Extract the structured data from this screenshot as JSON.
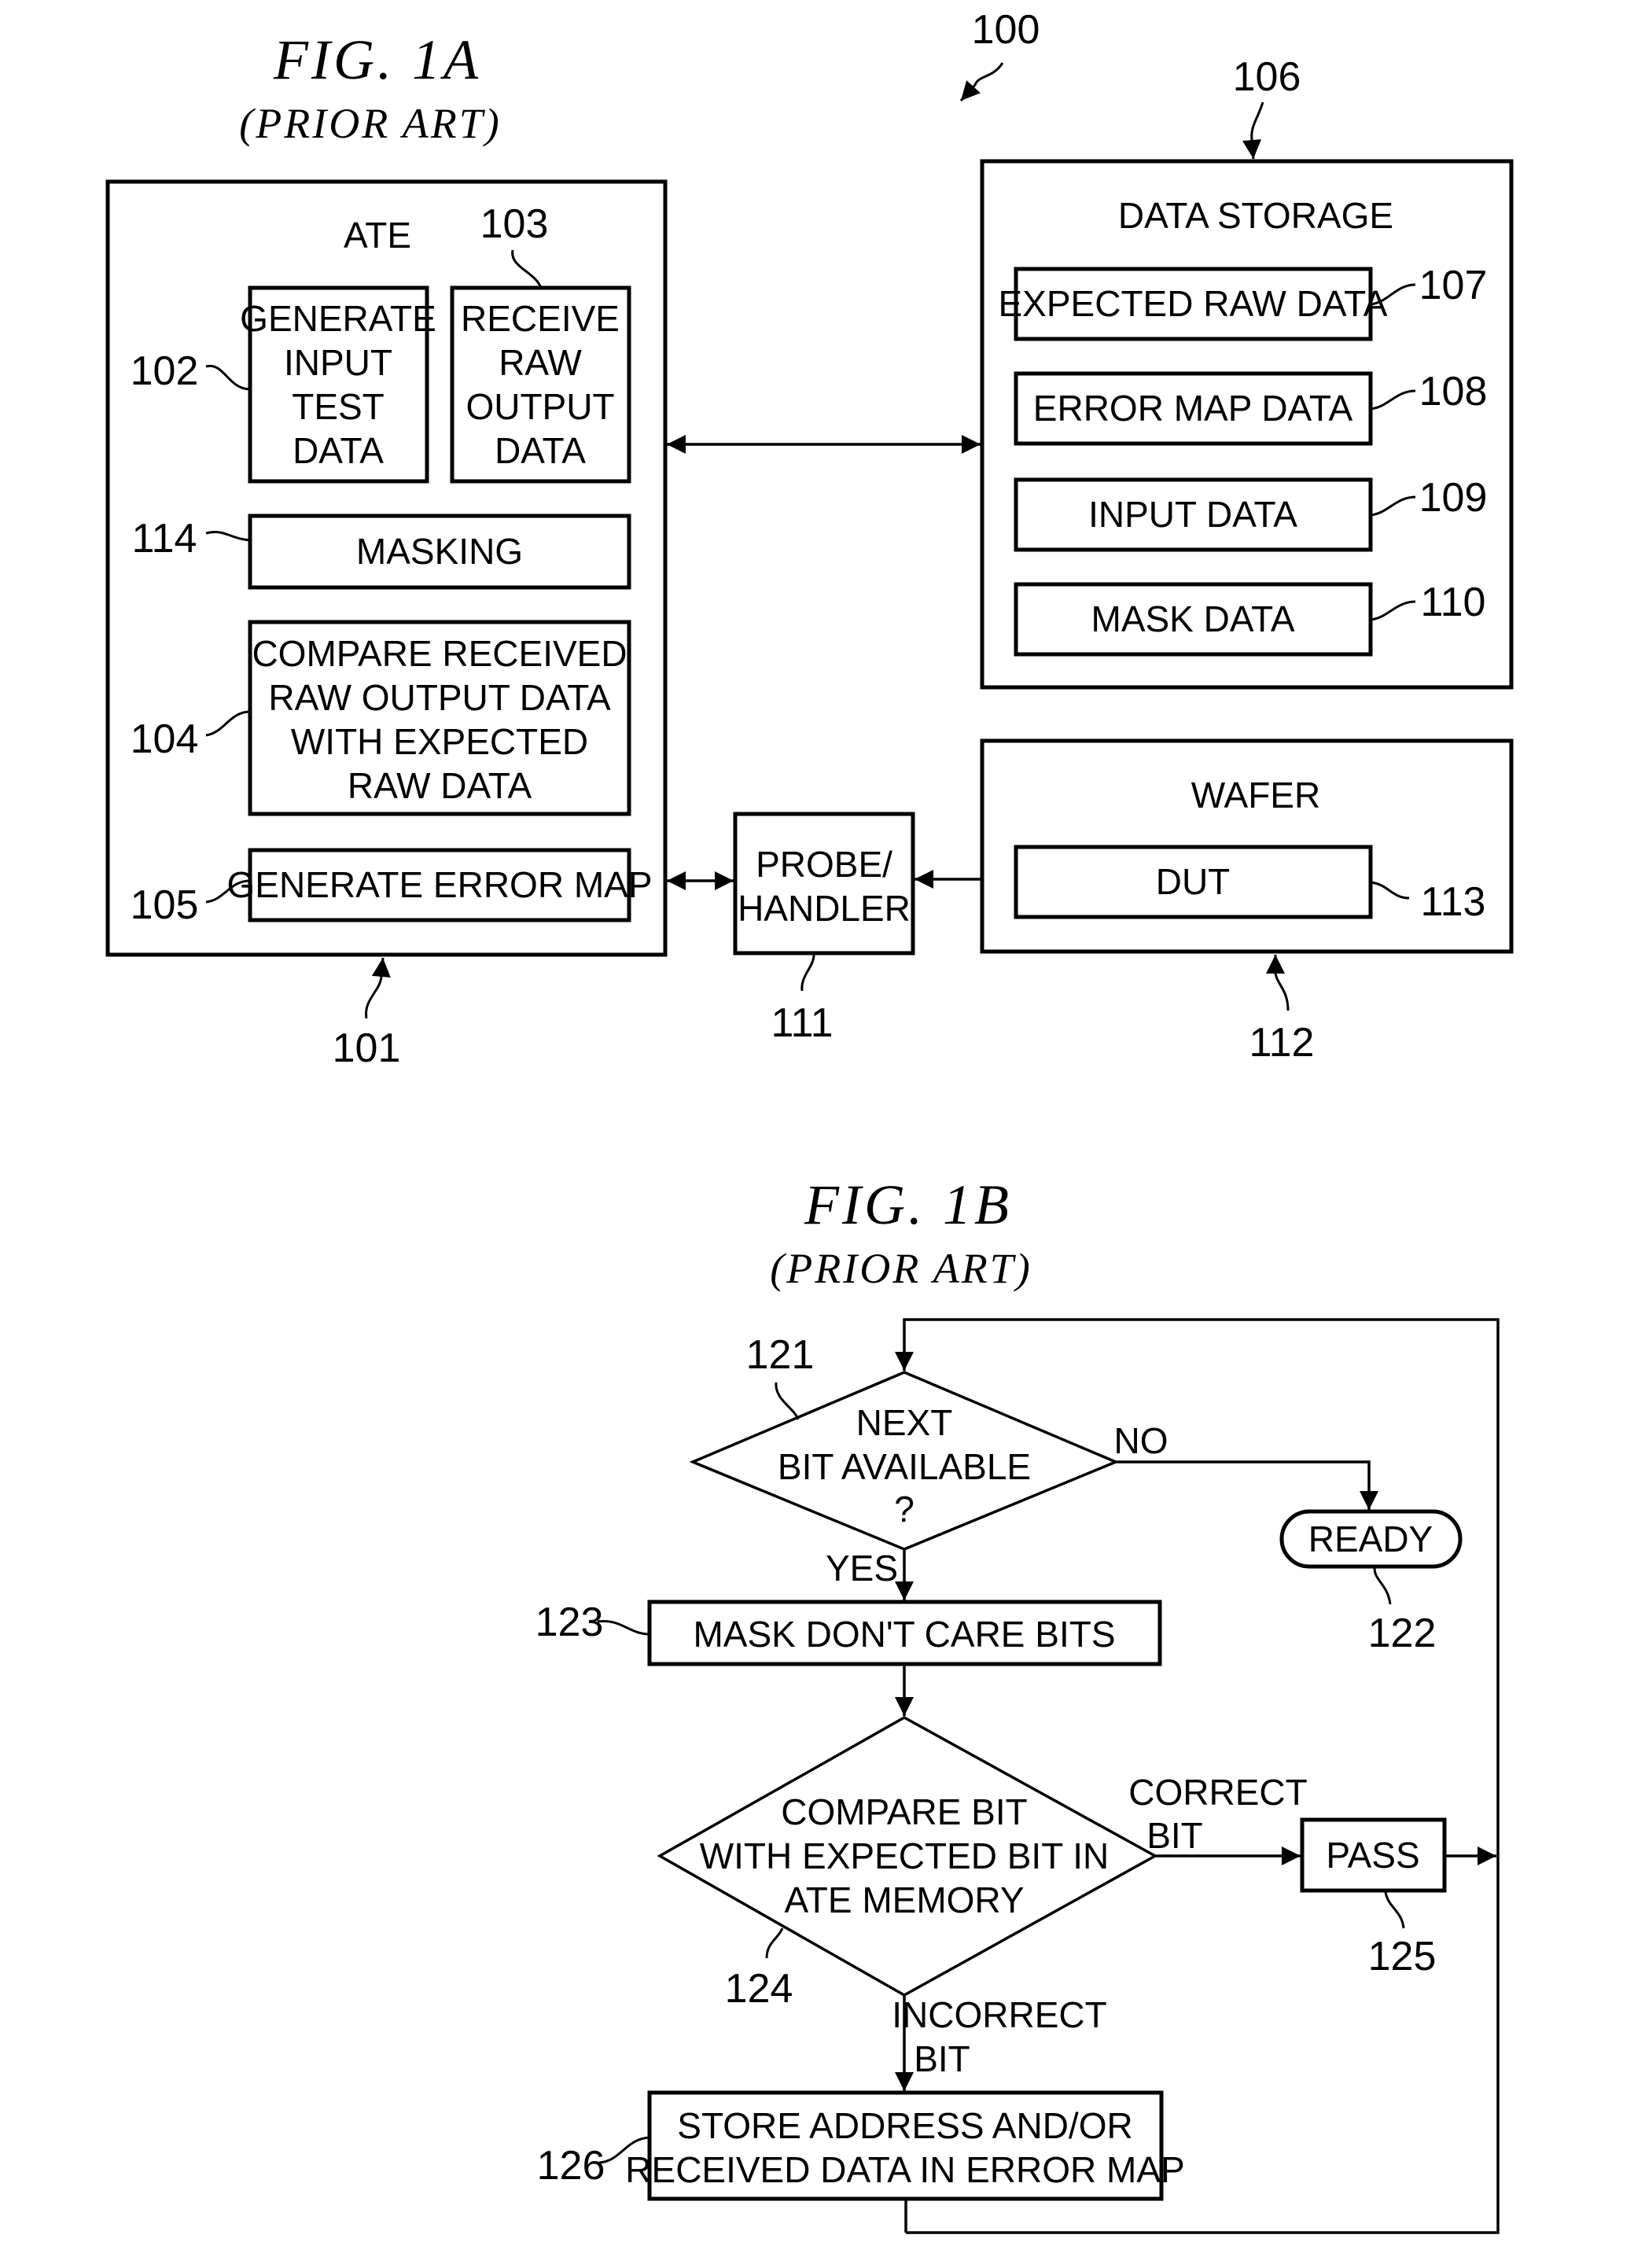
{
  "fig1a": {
    "title": "FIG. 1A",
    "subtitle": "(PRIOR ART)",
    "system_ref": "100",
    "ate": {
      "label": "ATE",
      "ref": "101",
      "blocks": [
        {
          "ref": "102",
          "lines": [
            "GENERATE",
            "INPUT",
            "TEST",
            "DATA"
          ]
        },
        {
          "ref": "103",
          "lines": [
            "RECEIVE",
            "RAW",
            "OUTPUT",
            "DATA"
          ]
        },
        {
          "ref": "114",
          "lines": [
            "MASKING"
          ]
        },
        {
          "ref": "104",
          "lines": [
            "COMPARE RECEIVED",
            "RAW OUTPUT DATA",
            "WITH EXPECTED",
            "RAW DATA"
          ]
        },
        {
          "ref": "105",
          "lines": [
            "GENERATE ERROR MAP"
          ]
        }
      ]
    },
    "data_storage": {
      "label": "DATA STORAGE",
      "ref": "106",
      "blocks": [
        {
          "ref": "107",
          "label": "EXPECTED RAW DATA"
        },
        {
          "ref": "108",
          "label": "ERROR MAP DATA"
        },
        {
          "ref": "109",
          "label": "INPUT DATA"
        },
        {
          "ref": "110",
          "label": "MASK DATA"
        }
      ]
    },
    "probe": {
      "lines": [
        "PROBE/",
        "HANDLER"
      ],
      "ref": "111"
    },
    "wafer": {
      "label": "WAFER",
      "ref": "112",
      "dut": {
        "label": "DUT",
        "ref": "113"
      }
    }
  },
  "fig1b": {
    "title": "FIG. 1B",
    "subtitle": "(PRIOR ART)",
    "decision_next": {
      "ref": "121",
      "lines": [
        "NEXT",
        "BIT AVAILABLE",
        "?"
      ],
      "no_label": "NO",
      "yes_label": "YES"
    },
    "ready": {
      "ref": "122",
      "label": "READY"
    },
    "mask": {
      "ref": "123",
      "label": "MASK DON'T CARE BITS"
    },
    "decision_compare": {
      "ref": "124",
      "lines": [
        "COMPARE BIT",
        "WITH EXPECTED BIT IN",
        "ATE MEMORY"
      ],
      "correct_label": [
        "CORRECT",
        "BIT"
      ],
      "incorrect_label": [
        "INCORRECT",
        "BIT"
      ]
    },
    "pass": {
      "ref": "125",
      "label": "PASS"
    },
    "store": {
      "ref": "126",
      "lines": [
        "STORE ADDRESS AND/OR",
        "RECEIVED DATA IN ERROR MAP"
      ]
    }
  }
}
